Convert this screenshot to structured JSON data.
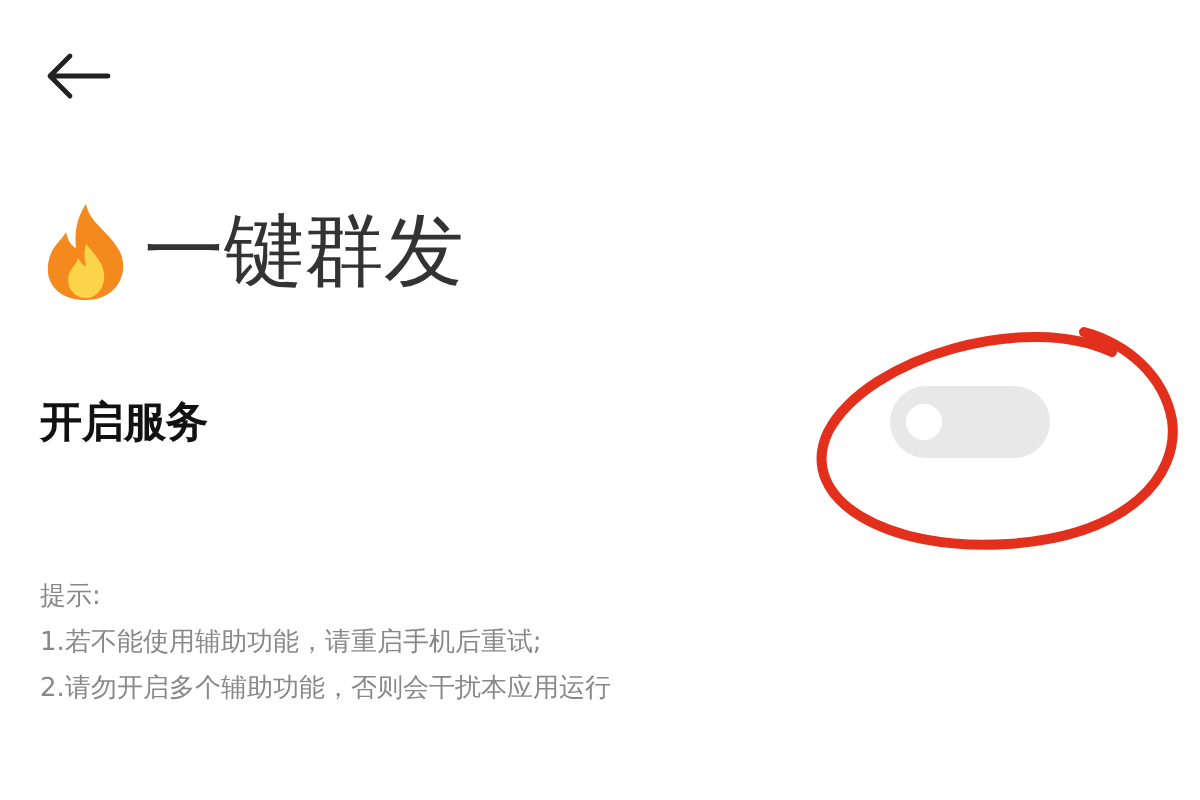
{
  "title": "一键群发",
  "service": {
    "label": "开启服务",
    "on": false
  },
  "hints": [
    "提示:",
    "1.若不能使用辅助功能，请重启手机后重试;",
    "2.请勿开启多个辅助功能，否则会干扰本应用运行"
  ]
}
